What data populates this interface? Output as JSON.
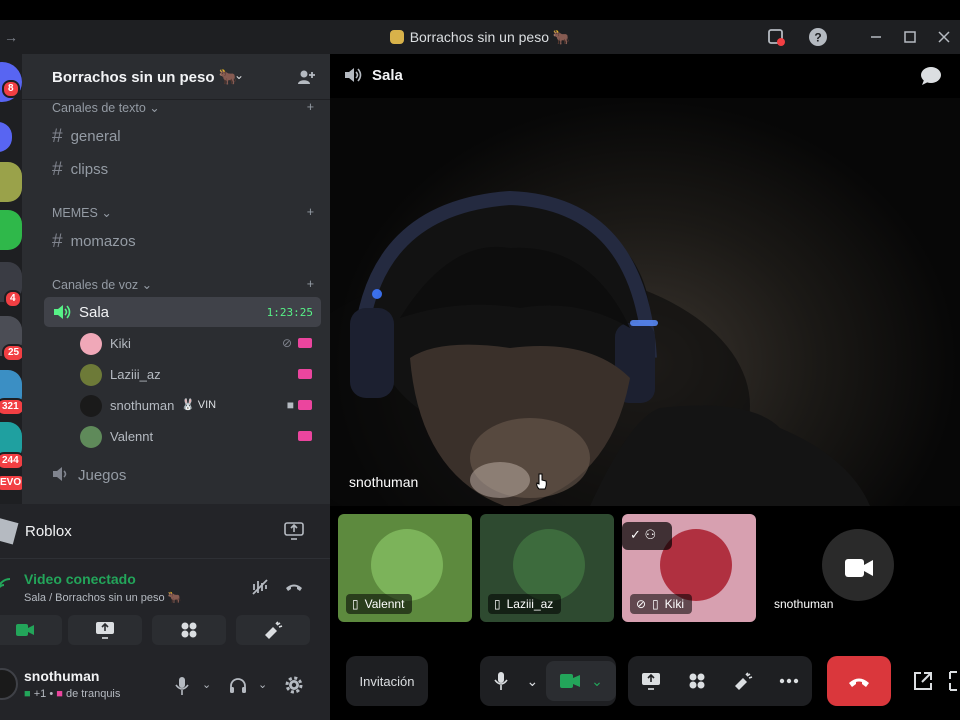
{
  "window": {
    "title": "Borrachos sin un peso 🐂",
    "nav_arrow": "→"
  },
  "rail": {
    "badges": [
      "8",
      "4",
      "25",
      "321",
      "244",
      "EVO"
    ]
  },
  "server": {
    "name": "Borrachos sin un peso 🐂"
  },
  "channels": {
    "text_category": "Canales de texto",
    "text_channels": [
      "general",
      "clipss"
    ],
    "memes_category": "MEMES",
    "memes_channels": [
      "momazos"
    ],
    "voice_category": "Canales de voz",
    "voice_channels": [
      {
        "name": "Sala",
        "timer": "1:23:25"
      },
      {
        "name": "Juegos"
      }
    ],
    "voice_members": [
      {
        "name": "Kiki"
      },
      {
        "name": "Laziii_az"
      },
      {
        "name": "snothuman",
        "tag": "🐰 VIN"
      },
      {
        "name": "Valennt"
      }
    ]
  },
  "activity": {
    "name": "Roblox"
  },
  "rtc": {
    "status": "Video conectado",
    "location": "Sala / Borrachos sin un peso 🐂"
  },
  "user": {
    "name": "snothuman",
    "status": "de tranquis",
    "status_prefix": "+1 •"
  },
  "main": {
    "channel": "Sala",
    "focused_name": "snothuman",
    "tiles": [
      {
        "name": "Valennt"
      },
      {
        "name": "Laziii_az"
      },
      {
        "name": "Kiki"
      },
      {
        "name": "snothuman"
      }
    ],
    "invite_label": "Invitación"
  },
  "colors": {
    "accent_green": "#23a55a",
    "danger_red": "#da373c",
    "badge_red": "#f23f43",
    "stream_pink": "#eb459e"
  },
  "icons": [
    "speaker-icon",
    "hash-icon",
    "chat-icon",
    "camera-icon",
    "mic-icon",
    "headset-icon",
    "gear-icon",
    "hangup-icon",
    "screen-share-icon",
    "activities-icon",
    "soundboard-icon",
    "more-icon",
    "popout-icon"
  ]
}
